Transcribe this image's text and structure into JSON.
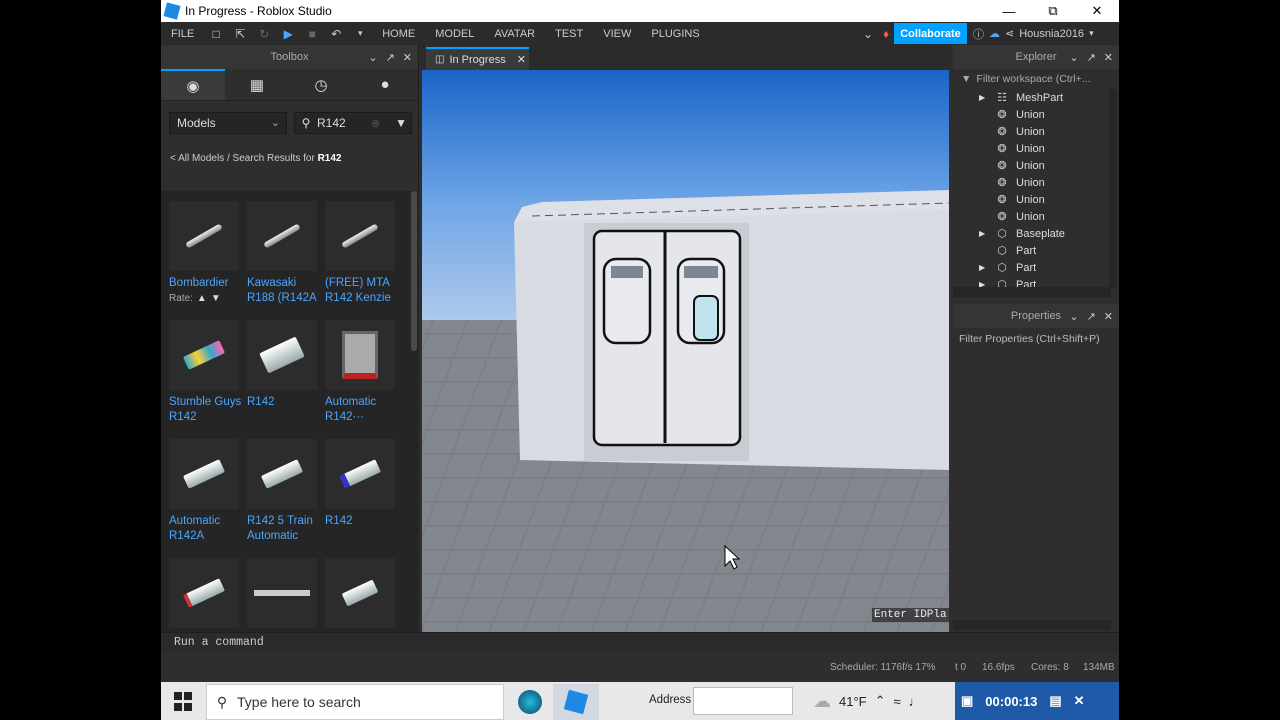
{
  "window": {
    "title": "In Progress - Roblox Studio"
  },
  "menubar": {
    "file": "FILE",
    "tabs": [
      "HOME",
      "MODEL",
      "AVATAR",
      "TEST",
      "VIEW",
      "PLUGINS"
    ],
    "collaborate": "Collaborate",
    "username": "Housnia2016"
  },
  "toolbox": {
    "title": "Toolbox",
    "category": "Models",
    "search_value": "R142",
    "breadcrumb_prefix": "< All Models / Search Results for ",
    "breadcrumb_query": "R142",
    "rate_label": "Rate:",
    "items": [
      {
        "name": "Bombardier",
        "icon": "rod"
      },
      {
        "name": "Kawasaki R188 (R142A",
        "icon": "rod"
      },
      {
        "name": "(FREE) MTA R142 Kenzie",
        "icon": "rod"
      },
      {
        "name": "Stumble Guys R142",
        "icon": "train-painted"
      },
      {
        "name": "R142",
        "icon": "train"
      },
      {
        "name": "Automatic R142···",
        "icon": "train-front"
      },
      {
        "name": "Automatic R142A",
        "icon": "train"
      },
      {
        "name": "R142 5 Train Automatic",
        "icon": "train"
      },
      {
        "name": "R142",
        "icon": "train"
      },
      {
        "name": "",
        "icon": "train"
      },
      {
        "name": "",
        "icon": "train-long"
      },
      {
        "name": "",
        "icon": "train"
      }
    ]
  },
  "viewport": {
    "tab": "In Progress",
    "hint": "Enter IDPla"
  },
  "explorer": {
    "title": "Explorer",
    "filter": "Filter workspace (Ctrl+...",
    "rows": [
      {
        "label": "MeshPart",
        "icon": "meshpart-icon",
        "expandable": true
      },
      {
        "label": "Union",
        "icon": "union-icon",
        "expandable": false
      },
      {
        "label": "Union",
        "icon": "union-icon",
        "expandable": false
      },
      {
        "label": "Union",
        "icon": "union-icon",
        "expandable": false
      },
      {
        "label": "Union",
        "icon": "union-icon",
        "expandable": false
      },
      {
        "label": "Union",
        "icon": "union-icon",
        "expandable": false
      },
      {
        "label": "Union",
        "icon": "union-icon",
        "expandable": false
      },
      {
        "label": "Union",
        "icon": "union-icon",
        "expandable": false
      },
      {
        "label": "Baseplate",
        "icon": "part-icon",
        "expandable": true
      },
      {
        "label": "Part",
        "icon": "part-icon",
        "expandable": false
      },
      {
        "label": "Part",
        "icon": "part-icon",
        "expandable": true
      },
      {
        "label": "Part",
        "icon": "part-icon",
        "expandable": true
      }
    ]
  },
  "properties": {
    "title": "Properties",
    "filter": "Filter Properties (Ctrl+Shift+P)"
  },
  "command": {
    "placeholder": "Run a command"
  },
  "status": {
    "scheduler": "Scheduler: 1176f/s 17%",
    "t": "t 0",
    "fps": "16.6fps",
    "cores": "Cores: 8",
    "mem": "134MB"
  },
  "taskbar": {
    "search_placeholder": "Type here to search",
    "address_label": "Address",
    "temperature": "41°F",
    "recorder_time": "00:00:13"
  },
  "colors": {
    "accent": "#00a2ff",
    "link": "#4aa7ff",
    "panel": "#2e2e2e"
  }
}
